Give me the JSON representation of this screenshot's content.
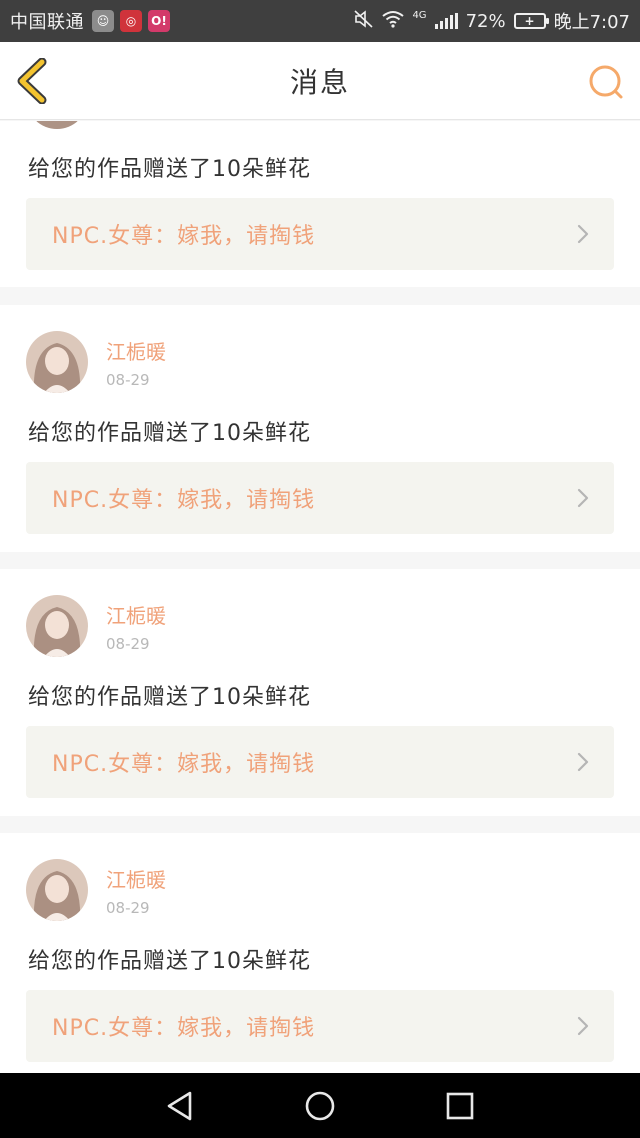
{
  "status_bar": {
    "carrier": "中国联通",
    "network": "4G",
    "battery": "72%",
    "time": "晚上7:07"
  },
  "header": {
    "title": "消息"
  },
  "messages": [
    {
      "username": "",
      "date": "",
      "text": "给您的作品赠送了10朵鲜花",
      "work_title": "NPC.女尊：嫁我，请掏钱"
    },
    {
      "username": "江栀暖",
      "date": "08-29",
      "text": "给您的作品赠送了10朵鲜花",
      "work_title": "NPC.女尊：嫁我，请掏钱"
    },
    {
      "username": "江栀暖",
      "date": "08-29",
      "text": "给您的作品赠送了10朵鲜花",
      "work_title": "NPC.女尊：嫁我，请掏钱"
    },
    {
      "username": "江栀暖",
      "date": "08-29",
      "text": "给您的作品赠送了10朵鲜花",
      "work_title": "NPC.女尊：嫁我，请掏钱"
    }
  ],
  "colors": {
    "accent": "#f0a27a",
    "back_icon": "#f4c430",
    "search_icon": "#f5a96a"
  },
  "icons": {
    "back": "chevron-left-icon",
    "search": "search-icon",
    "link_arrow": "chevron-right-icon",
    "sys_back": "triangle-back-icon",
    "sys_home": "circle-home-icon",
    "sys_recent": "square-recent-icon"
  }
}
